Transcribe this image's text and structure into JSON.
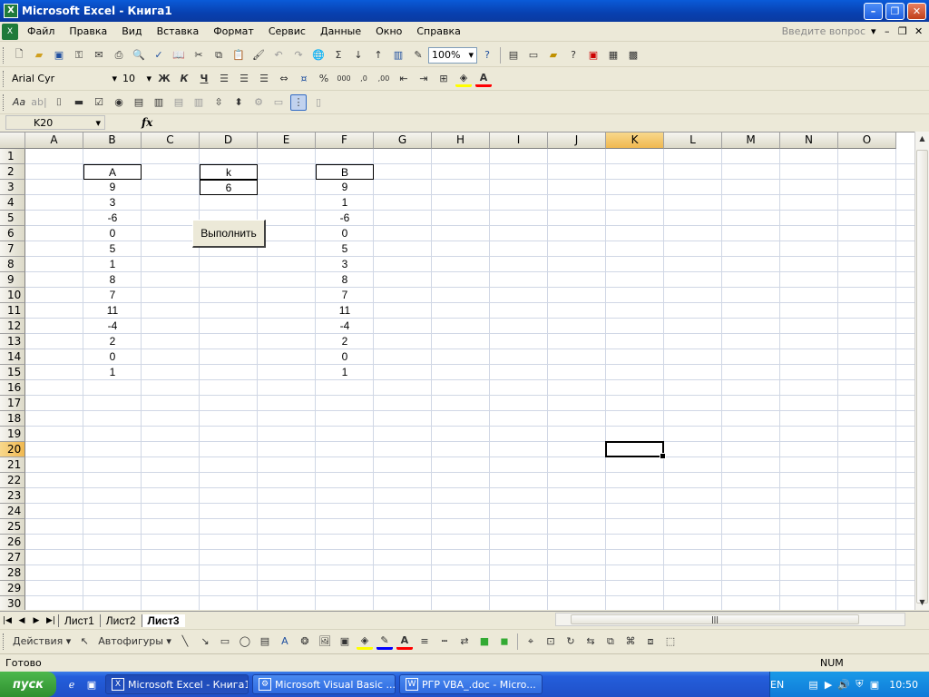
{
  "window": {
    "title": "Microsoft Excel - Книга1",
    "app_icon": "excel-icon"
  },
  "menu": {
    "items": [
      "Файл",
      "Правка",
      "Вид",
      "Вставка",
      "Формат",
      "Сервис",
      "Данные",
      "Окно",
      "Справка"
    ],
    "ask_placeholder": "Введите вопрос"
  },
  "toolbar": {
    "zoom": "100%"
  },
  "format_toolbar": {
    "font": "Arial Cyr",
    "size": "10",
    "bold": "Ж",
    "italic": "К",
    "underline": "Ч"
  },
  "formula_bar": {
    "name_box": "K20",
    "fx_label": "fx",
    "formula": ""
  },
  "sheet": {
    "columns": [
      "A",
      "B",
      "C",
      "D",
      "E",
      "F",
      "G",
      "H",
      "I",
      "J",
      "K",
      "L",
      "M",
      "N",
      "O"
    ],
    "selected_column": "K",
    "rows": [
      "1",
      "2",
      "3",
      "4",
      "5",
      "6",
      "7",
      "8",
      "9",
      "10",
      "11",
      "12",
      "13",
      "14",
      "15",
      "16",
      "17",
      "18",
      "19",
      "20",
      "21",
      "22",
      "23",
      "24",
      "25",
      "26",
      "27",
      "28",
      "29",
      "30"
    ],
    "selected_row": "20",
    "col_a_header": "A",
    "col_b_values": [
      "9",
      "3",
      "-6",
      "0",
      "5",
      "1",
      "8",
      "7",
      "11",
      "-4",
      "2",
      "0",
      "1"
    ],
    "k_header": "k",
    "k_value": "6",
    "col_f_header": "B",
    "col_f_values": [
      "9",
      "1",
      "-6",
      "0",
      "5",
      "3",
      "8",
      "7",
      "11",
      "-4",
      "2",
      "0",
      "1"
    ],
    "run_button": "Выполнить"
  },
  "tabs": {
    "items": [
      "Лист1",
      "Лист2",
      "Лист3"
    ],
    "active": "Лист3"
  },
  "draw_toolbar": {
    "actions": "Действия",
    "autoshapes": "Автофигуры"
  },
  "status": {
    "left": "Готово",
    "right": "NUM"
  },
  "taskbar": {
    "start": "пуск",
    "tasks": [
      "Microsoft Excel - Книга1",
      "Microsoft Visual Basic ...",
      "РГР VBA_.doc - Micro..."
    ],
    "lang": "EN",
    "clock": "10:50"
  }
}
